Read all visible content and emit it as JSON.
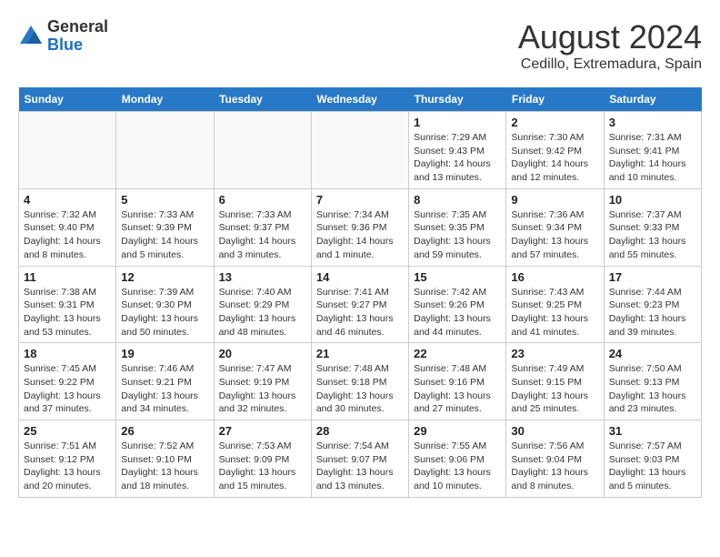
{
  "header": {
    "logo_general": "General",
    "logo_blue": "Blue",
    "month_year": "August 2024",
    "location": "Cedillo, Extremadura, Spain"
  },
  "weekdays": [
    "Sunday",
    "Monday",
    "Tuesday",
    "Wednesday",
    "Thursday",
    "Friday",
    "Saturday"
  ],
  "weeks": [
    [
      {
        "day": "",
        "info": ""
      },
      {
        "day": "",
        "info": ""
      },
      {
        "day": "",
        "info": ""
      },
      {
        "day": "",
        "info": ""
      },
      {
        "day": "1",
        "info": "Sunrise: 7:29 AM\nSunset: 9:43 PM\nDaylight: 14 hours\nand 13 minutes."
      },
      {
        "day": "2",
        "info": "Sunrise: 7:30 AM\nSunset: 9:42 PM\nDaylight: 14 hours\nand 12 minutes."
      },
      {
        "day": "3",
        "info": "Sunrise: 7:31 AM\nSunset: 9:41 PM\nDaylight: 14 hours\nand 10 minutes."
      }
    ],
    [
      {
        "day": "4",
        "info": "Sunrise: 7:32 AM\nSunset: 9:40 PM\nDaylight: 14 hours\nand 8 minutes."
      },
      {
        "day": "5",
        "info": "Sunrise: 7:33 AM\nSunset: 9:39 PM\nDaylight: 14 hours\nand 5 minutes."
      },
      {
        "day": "6",
        "info": "Sunrise: 7:33 AM\nSunset: 9:37 PM\nDaylight: 14 hours\nand 3 minutes."
      },
      {
        "day": "7",
        "info": "Sunrise: 7:34 AM\nSunset: 9:36 PM\nDaylight: 14 hours\nand 1 minute."
      },
      {
        "day": "8",
        "info": "Sunrise: 7:35 AM\nSunset: 9:35 PM\nDaylight: 13 hours\nand 59 minutes."
      },
      {
        "day": "9",
        "info": "Sunrise: 7:36 AM\nSunset: 9:34 PM\nDaylight: 13 hours\nand 57 minutes."
      },
      {
        "day": "10",
        "info": "Sunrise: 7:37 AM\nSunset: 9:33 PM\nDaylight: 13 hours\nand 55 minutes."
      }
    ],
    [
      {
        "day": "11",
        "info": "Sunrise: 7:38 AM\nSunset: 9:31 PM\nDaylight: 13 hours\nand 53 minutes."
      },
      {
        "day": "12",
        "info": "Sunrise: 7:39 AM\nSunset: 9:30 PM\nDaylight: 13 hours\nand 50 minutes."
      },
      {
        "day": "13",
        "info": "Sunrise: 7:40 AM\nSunset: 9:29 PM\nDaylight: 13 hours\nand 48 minutes."
      },
      {
        "day": "14",
        "info": "Sunrise: 7:41 AM\nSunset: 9:27 PM\nDaylight: 13 hours\nand 46 minutes."
      },
      {
        "day": "15",
        "info": "Sunrise: 7:42 AM\nSunset: 9:26 PM\nDaylight: 13 hours\nand 44 minutes."
      },
      {
        "day": "16",
        "info": "Sunrise: 7:43 AM\nSunset: 9:25 PM\nDaylight: 13 hours\nand 41 minutes."
      },
      {
        "day": "17",
        "info": "Sunrise: 7:44 AM\nSunset: 9:23 PM\nDaylight: 13 hours\nand 39 minutes."
      }
    ],
    [
      {
        "day": "18",
        "info": "Sunrise: 7:45 AM\nSunset: 9:22 PM\nDaylight: 13 hours\nand 37 minutes."
      },
      {
        "day": "19",
        "info": "Sunrise: 7:46 AM\nSunset: 9:21 PM\nDaylight: 13 hours\nand 34 minutes."
      },
      {
        "day": "20",
        "info": "Sunrise: 7:47 AM\nSunset: 9:19 PM\nDaylight: 13 hours\nand 32 minutes."
      },
      {
        "day": "21",
        "info": "Sunrise: 7:48 AM\nSunset: 9:18 PM\nDaylight: 13 hours\nand 30 minutes."
      },
      {
        "day": "22",
        "info": "Sunrise: 7:48 AM\nSunset: 9:16 PM\nDaylight: 13 hours\nand 27 minutes."
      },
      {
        "day": "23",
        "info": "Sunrise: 7:49 AM\nSunset: 9:15 PM\nDaylight: 13 hours\nand 25 minutes."
      },
      {
        "day": "24",
        "info": "Sunrise: 7:50 AM\nSunset: 9:13 PM\nDaylight: 13 hours\nand 23 minutes."
      }
    ],
    [
      {
        "day": "25",
        "info": "Sunrise: 7:51 AM\nSunset: 9:12 PM\nDaylight: 13 hours\nand 20 minutes."
      },
      {
        "day": "26",
        "info": "Sunrise: 7:52 AM\nSunset: 9:10 PM\nDaylight: 13 hours\nand 18 minutes."
      },
      {
        "day": "27",
        "info": "Sunrise: 7:53 AM\nSunset: 9:09 PM\nDaylight: 13 hours\nand 15 minutes."
      },
      {
        "day": "28",
        "info": "Sunrise: 7:54 AM\nSunset: 9:07 PM\nDaylight: 13 hours\nand 13 minutes."
      },
      {
        "day": "29",
        "info": "Sunrise: 7:55 AM\nSunset: 9:06 PM\nDaylight: 13 hours\nand 10 minutes."
      },
      {
        "day": "30",
        "info": "Sunrise: 7:56 AM\nSunset: 9:04 PM\nDaylight: 13 hours\nand 8 minutes."
      },
      {
        "day": "31",
        "info": "Sunrise: 7:57 AM\nSunset: 9:03 PM\nDaylight: 13 hours\nand 5 minutes."
      }
    ]
  ]
}
